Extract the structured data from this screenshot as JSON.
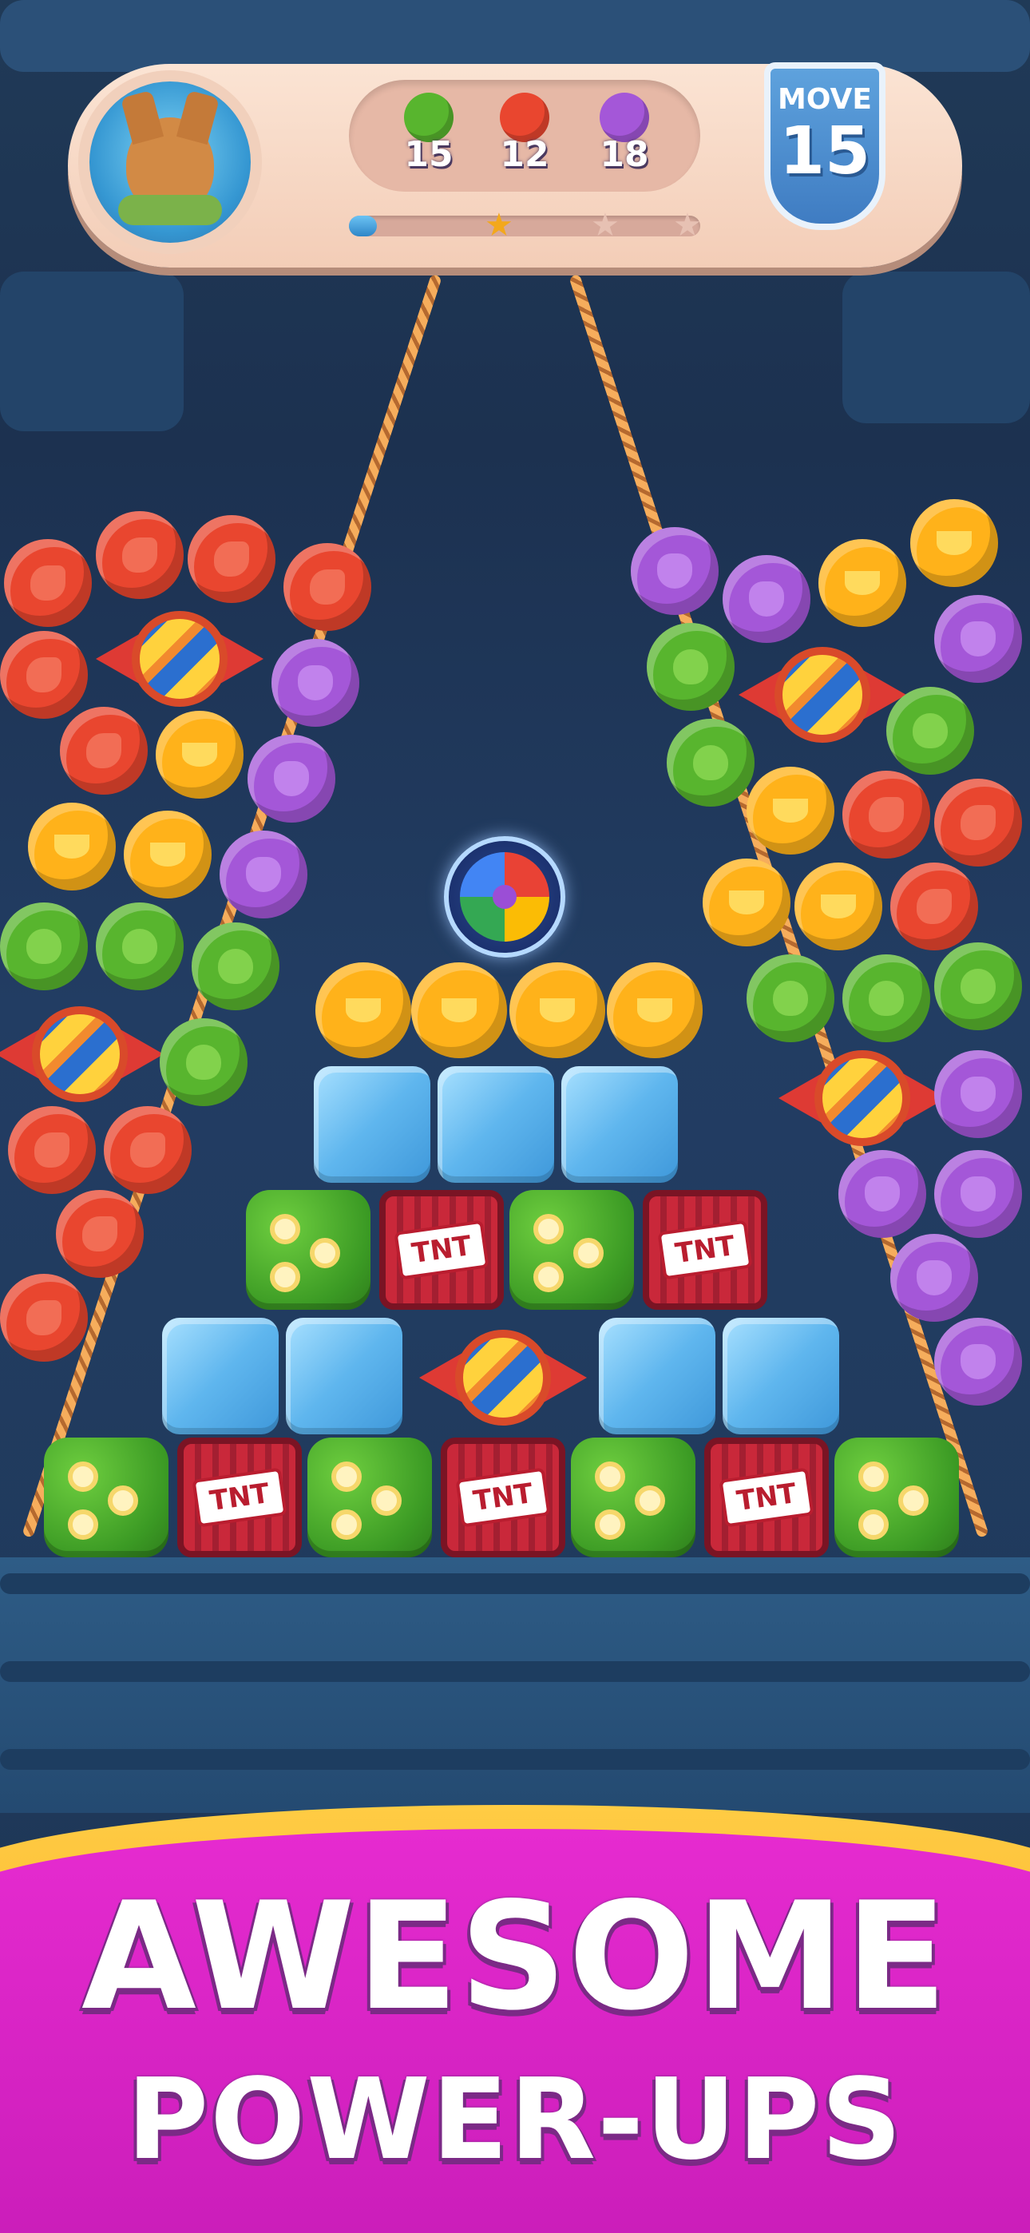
{
  "hud": {
    "goals": [
      {
        "icon": "apple-icon",
        "count": "15",
        "color": "#58b52e"
      },
      {
        "icon": "strawberry-icon",
        "count": "12",
        "color": "#e9462f"
      },
      {
        "icon": "grape-icon",
        "count": "18",
        "color": "#a457d8"
      }
    ],
    "progress": 0.08,
    "stars_earned": 1,
    "moves_label": "MOVE",
    "moves_value": "15"
  },
  "banner": {
    "line1": "AWESOME",
    "line2": "POWER-UPS"
  },
  "colors": {
    "apple": "#58b52e",
    "strawberry": "#e9462f",
    "banana": "#ffb21a",
    "grape": "#a457d8",
    "banner": "#d321c3",
    "banner_outline": "#7b2a86"
  }
}
